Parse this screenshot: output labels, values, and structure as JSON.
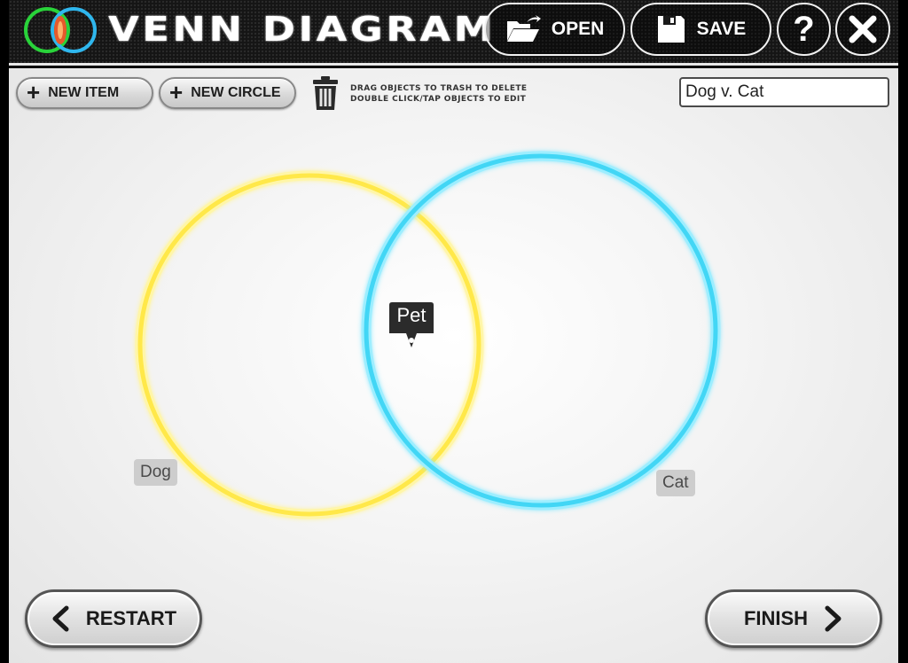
{
  "header": {
    "title": "VENN DIAGRAM",
    "open_label": "OPEN",
    "save_label": "SAVE",
    "help_label": "?"
  },
  "toolbar": {
    "new_item_label": "NEW ITEM",
    "new_circle_label": "NEW CIRCLE",
    "hint_line1": "DRAG OBJECTS TO TRASH TO DELETE",
    "hint_line2": "DOUBLE CLICK/TAP OBJECTS TO EDIT",
    "title_value": "Dog v. Cat"
  },
  "diagram": {
    "circles": [
      {
        "label": "Dog",
        "color": "#ffe84a"
      },
      {
        "label": "Cat",
        "color": "#43d6f5"
      }
    ],
    "items": [
      {
        "label": "Pet"
      }
    ]
  },
  "footer": {
    "restart_label": "RESTART",
    "finish_label": "FINISH"
  },
  "colors": {
    "header_bg": "#151515",
    "logo_green": "#29d33a",
    "logo_blue": "#2fb7ee",
    "logo_center": "#e65a2b",
    "item_bg": "#2b2b2b"
  }
}
